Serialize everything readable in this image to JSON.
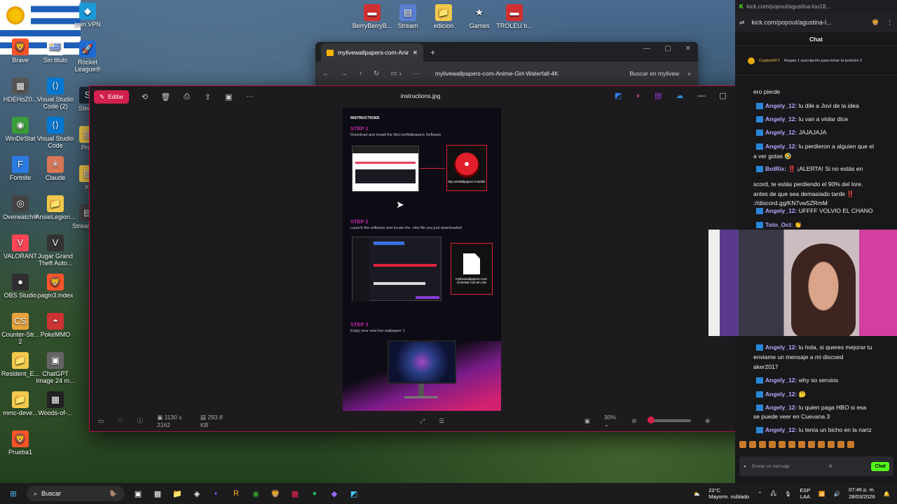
{
  "desktop": {
    "icons": [
      {
        "label": "Brave",
        "glyph": "🦁",
        "bg": "#fb542b"
      },
      {
        "label": "Sin titulo",
        "glyph": "🇺🇾",
        "bg": "#ffffff"
      },
      {
        "label": "HDEHoZ0...",
        "glyph": "▦",
        "bg": "#555"
      },
      {
        "label": "Visual Studio Code (2)",
        "glyph": "⟨⟩",
        "bg": "#0078d4"
      },
      {
        "label": "WinDirStat",
        "glyph": "◉",
        "bg": "#3a9d3a"
      },
      {
        "label": "Visual Studio Code",
        "glyph": "⟨⟩",
        "bg": "#0078d4"
      },
      {
        "label": "Fortnite",
        "glyph": "F",
        "bg": "#2a7be4"
      },
      {
        "label": "Claude",
        "glyph": "✳",
        "bg": "#d77655"
      },
      {
        "label": "Overwatch®",
        "glyph": "◎",
        "bg": "#444"
      },
      {
        "label": "AnsieLegion...",
        "glyph": "📁",
        "bg": "#f2c94c"
      },
      {
        "label": "VALORANT",
        "glyph": "V",
        "bg": "#fd4556"
      },
      {
        "label": "Jugar Grand Theft Auto...",
        "glyph": "V",
        "bg": "#333"
      },
      {
        "label": "OBS Studio",
        "glyph": "●",
        "bg": "#302e31"
      },
      {
        "label": "pagin3.index",
        "glyph": "🦁",
        "bg": "#fb542b"
      },
      {
        "label": "Counter-Str... 2",
        "glyph": "CS",
        "bg": "#e8a33d"
      },
      {
        "label": "PokeMMO",
        "glyph": "◓",
        "bg": "#c33"
      },
      {
        "label": "Resident_E...",
        "glyph": "📁",
        "bg": "#f2c94c"
      },
      {
        "label": "ChatGPT Image 24 m...",
        "glyph": "▣",
        "bg": "#666"
      },
      {
        "label": "mmc-deve...",
        "glyph": "📁",
        "bg": "#f2c94c"
      },
      {
        "label": "Woods-of-...",
        "glyph": "▦",
        "bg": "#222"
      },
      {
        "label": "Prueba1",
        "glyph": "🦁",
        "bg": "#fb542b"
      },
      {
        "label": "Stream",
        "glyph": "▤",
        "bg": "#5a7fd0"
      },
      {
        "label": "edicion",
        "glyph": "📁",
        "bg": "#f2c94c"
      },
      {
        "label": "Games",
        "glyph": "★",
        "bg": "transparent"
      },
      {
        "label": "TROLEU b...",
        "glyph": "▬",
        "bg": "#d03030"
      },
      {
        "label": "BerryBerryB...",
        "glyph": "▬",
        "bg": "#d03030"
      },
      {
        "label": "Rocket League®",
        "glyph": "🚀",
        "bg": "#1f6bd1"
      },
      {
        "label": "lmin VPN",
        "glyph": "◆",
        "bg": "#1a9ad6"
      },
      {
        "label": "Steam",
        "glyph": "S",
        "bg": "#1b2838"
      },
      {
        "label": "Proy",
        "glyph": "▤",
        "bg": "#f2c94c"
      },
      {
        "label": "m",
        "glyph": "▤",
        "bg": "#f2c94c"
      },
      {
        "label": "Strear SE.I",
        "glyph": "▤",
        "bg": "#444"
      }
    ]
  },
  "browser": {
    "tab_title": "mylivewallpapers-com-Anime",
    "url": "mylivewallpapers-com-Anime-Girl-Waterfall-4K",
    "search_label": "Buscar en mylivew"
  },
  "viewer": {
    "edit_label": "Editar",
    "filename": "instructions.jpg",
    "dimensions": "1130 x 2162",
    "filesize": "293.8 KB",
    "zoom": "30%",
    "zoom_level": 0.0,
    "doc": {
      "header": "INSTRUCTIONS",
      "step1_title": "STEP 1",
      "step1_desc": "Download and install the MyLiveWallpapers Software",
      "step1_box": "MyLiveWallpapers Installer",
      "step2_title": "STEP 2",
      "step2_desc": "Launch the software and locate the .mlw file you just downloaded",
      "step2_box": "mylivewallpapers-com-Celestial-Cat-4K.mlw",
      "step3_title": "STEP 3",
      "step3_desc": "Enjoy your new live wallpaper :)"
    }
  },
  "chat": {
    "top_url": "kick.com/popout/agustina-lou18...",
    "url": "kick.com/popout/agustina-l...",
    "header": "Chat",
    "pinned_user": "CryptonRFT",
    "pinned_text": "Regala 1 suscripción para tomar la posición 2",
    "messages": [
      {
        "kind": "cont",
        "text": "ero pierde"
      },
      {
        "kind": "msg",
        "user": "Angely_12:",
        "text": "lu dile a Jovi de la idea"
      },
      {
        "kind": "msg",
        "user": "Angely_12:",
        "text": "lu van a violar dice"
      },
      {
        "kind": "msg",
        "user": "Angely_12:",
        "text": "JAJAJAJA"
      },
      {
        "kind": "msg",
        "user": "Angely_12:",
        "text": "lu perdieron a alguien que el"
      },
      {
        "kind": "cont",
        "text": "a ver gotas 🤣"
      },
      {
        "kind": "msg",
        "user": "BotRix:",
        "text": "‼️ ¡ALERTA! Si no estás en"
      },
      {
        "kind": "cont",
        "text": "scord, te estás perdiendo el 90% del lore."
      },
      {
        "kind": "cont",
        "text": "antes de que sea demasiado tarde ‼️"
      },
      {
        "kind": "cont",
        "text": "://discord.gg/KN7vw5ZRmM"
      },
      {
        "kind": "msg",
        "user": "Angely_12:",
        "text": "UFFFF VOLVIO EL CHANO"
      },
      {
        "kind": "msg",
        "user": "Toto_Oct:",
        "text": "👏"
      },
      {
        "kind": "msg",
        "user": "Angely_12:",
        "text": "lu hola, si queres mejorar tu"
      },
      {
        "kind": "cont",
        "text": "enviame un mensaje a mi discoed"
      },
      {
        "kind": "cont",
        "text": "aker2017"
      },
      {
        "kind": "msg",
        "user": "Angely_12:",
        "text": "why so seruios"
      },
      {
        "kind": "msg",
        "user": "Angely_12:",
        "text": "🤔"
      },
      {
        "kind": "msg",
        "user": "Angely_12:",
        "text": "lu quien paga HBO si esa"
      },
      {
        "kind": "cont",
        "text": "se puede veer en Cuevana 3"
      },
      {
        "kind": "msg",
        "user": "Angely_12:",
        "text": "lu tenía un bicho en la nariz"
      }
    ],
    "input_placeholder": "Enviar un mensaje",
    "send_label": "Chat"
  },
  "taskbar": {
    "search_label": "Buscar",
    "weather_temp": "23°C",
    "weather_desc": "Mayorm. nublado",
    "lang": "ESP",
    "region": "LAA",
    "time": "07:46 p. m.",
    "date": "28/03/2026"
  }
}
